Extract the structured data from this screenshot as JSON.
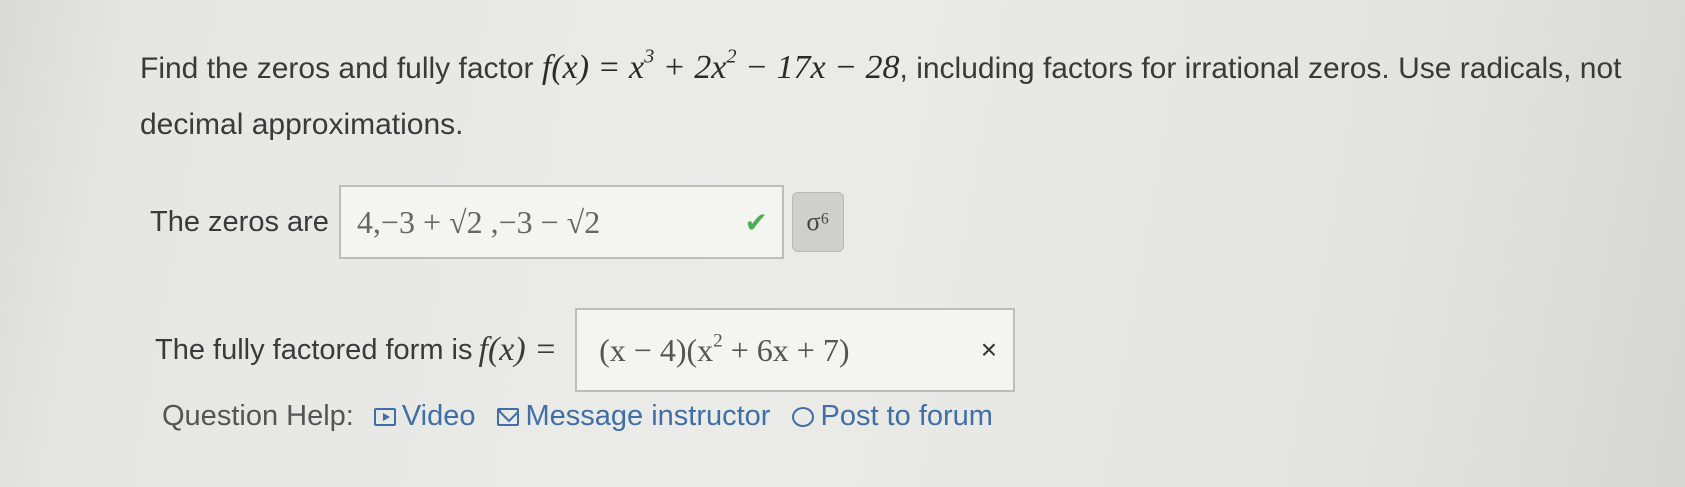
{
  "question": {
    "text_before": "Find the zeros and fully factor ",
    "function_lhs": "f(x) = x",
    "exp3": "3",
    "term2": " + 2x",
    "exp2": "2",
    "term3": " − 17x − 28",
    "text_after": ", including factors for irrational zeros. Use radicals, not decimal approximations."
  },
  "zeros": {
    "label": "The zeros are",
    "answer": "4,−3 + √2 ,−3 − √2",
    "status_icon": "check-icon",
    "preview_button": "σ⁶"
  },
  "factored": {
    "label": "The fully factored form is ",
    "lhs": "f(x) =",
    "answer_part1": "(x − 4)(x",
    "answer_exp": "2",
    "answer_part2": " + 6x + 7)",
    "status_icon": "cross-icon",
    "status_glyph": "×"
  },
  "help": {
    "label": "Question Help:",
    "video": "Video",
    "message": "Message instructor",
    "forum": "Post to forum"
  },
  "colors": {
    "link": "#3f6fa6",
    "correct": "#4caf50"
  }
}
